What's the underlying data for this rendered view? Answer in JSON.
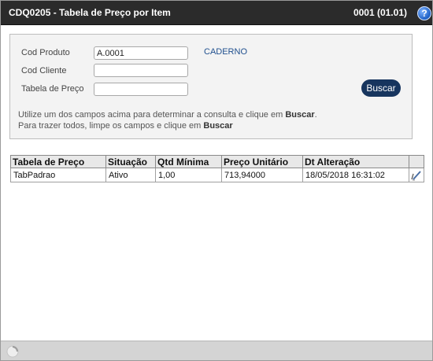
{
  "window": {
    "title": "CDQ0205 - Tabela de Preço por Item",
    "user_info": "0001 (01.01)",
    "help_icon": "question-mark-icon",
    "help_symbol": "?"
  },
  "search": {
    "cod_produto": {
      "label": "Cod Produto",
      "value": "A.0001",
      "description": "CADERNO"
    },
    "cod_cliente": {
      "label": "Cod Cliente",
      "value": ""
    },
    "tabela_preco": {
      "label": "Tabela de Preço",
      "value": ""
    },
    "search_button": "Buscar",
    "hint_line1_prefix": "Utilize um dos campos acima para determinar a consulta e clique em ",
    "hint_line1_bold": "Buscar",
    "hint_line1_suffix": ".",
    "hint_line2_prefix": "Para trazer todos, limpe os campos e clique em ",
    "hint_line2_bold": "Buscar"
  },
  "table": {
    "columns": [
      "Tabela de Preço",
      "Situação",
      "Qtd Mínima",
      "Preço Unitário",
      "Dt Alteração",
      ""
    ],
    "rows": [
      {
        "tabela": "TabPadrao",
        "situacao": "Ativo",
        "qtd_minima": "1,00",
        "preco_unitario": "713,94000",
        "dt_alteracao": "18/05/2018 16:31:02",
        "action_icon": "edit-pen-icon"
      }
    ]
  },
  "status_bar": {
    "icon": "loading-spinner-icon"
  },
  "colors": {
    "titlebar": "#2b2b2b",
    "button": "#17355e",
    "description": "#1f4f8e",
    "panel": "#f3f3f3"
  }
}
